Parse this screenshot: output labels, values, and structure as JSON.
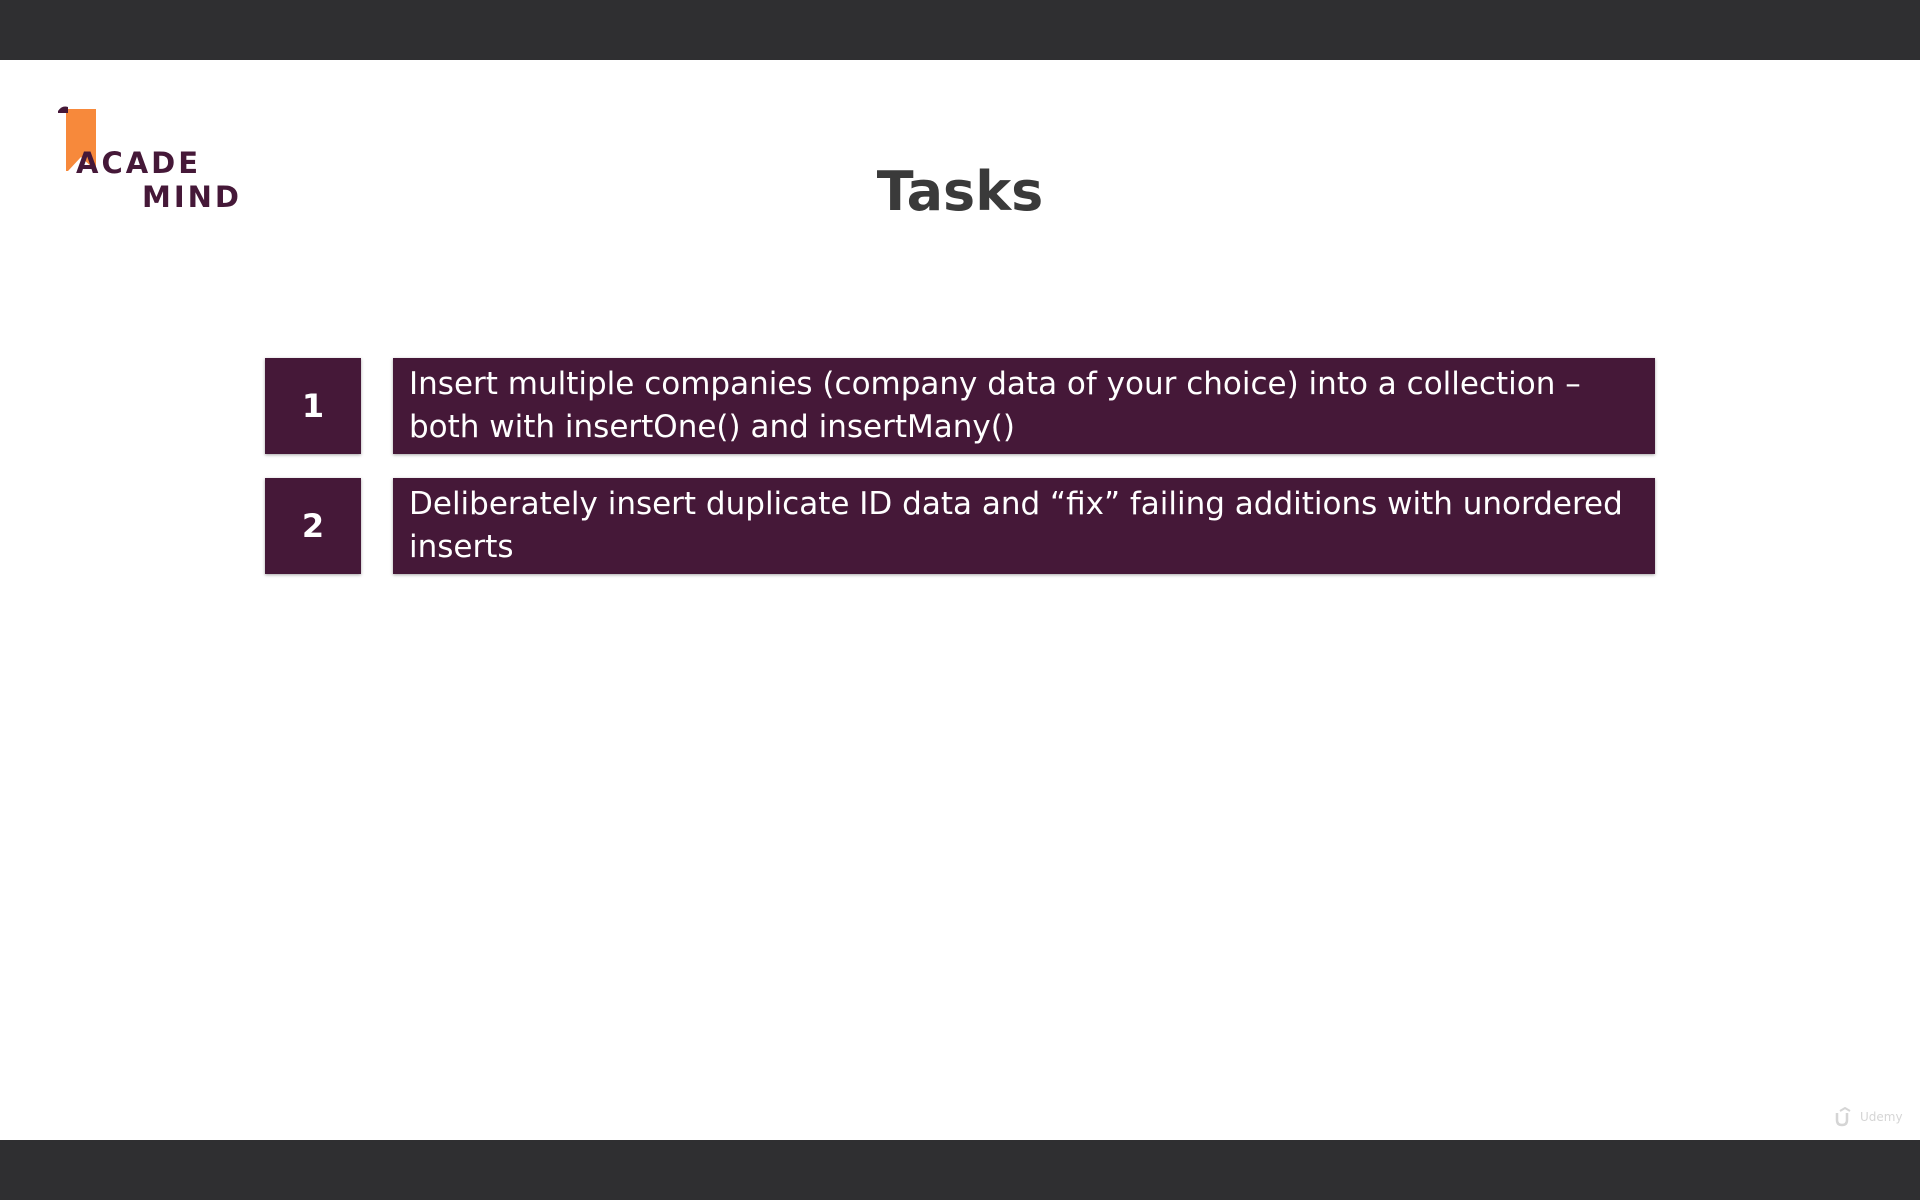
{
  "slide": {
    "title": "Tasks",
    "logo": {
      "line1": "ACADE",
      "line2": "MIND",
      "accent_color": "#f7893b",
      "brand_color": "#451838"
    },
    "tasks": [
      {
        "number": "1",
        "text": "Insert multiple companies (company data of your choice) into a collection – both with insertOne() and insertMany()"
      },
      {
        "number": "2",
        "text": "Deliberately insert duplicate ID data and “fix” failing additions with unordered inserts"
      }
    ],
    "watermark": {
      "text": "Udemy",
      "icon": "udemy-logo-icon"
    }
  }
}
